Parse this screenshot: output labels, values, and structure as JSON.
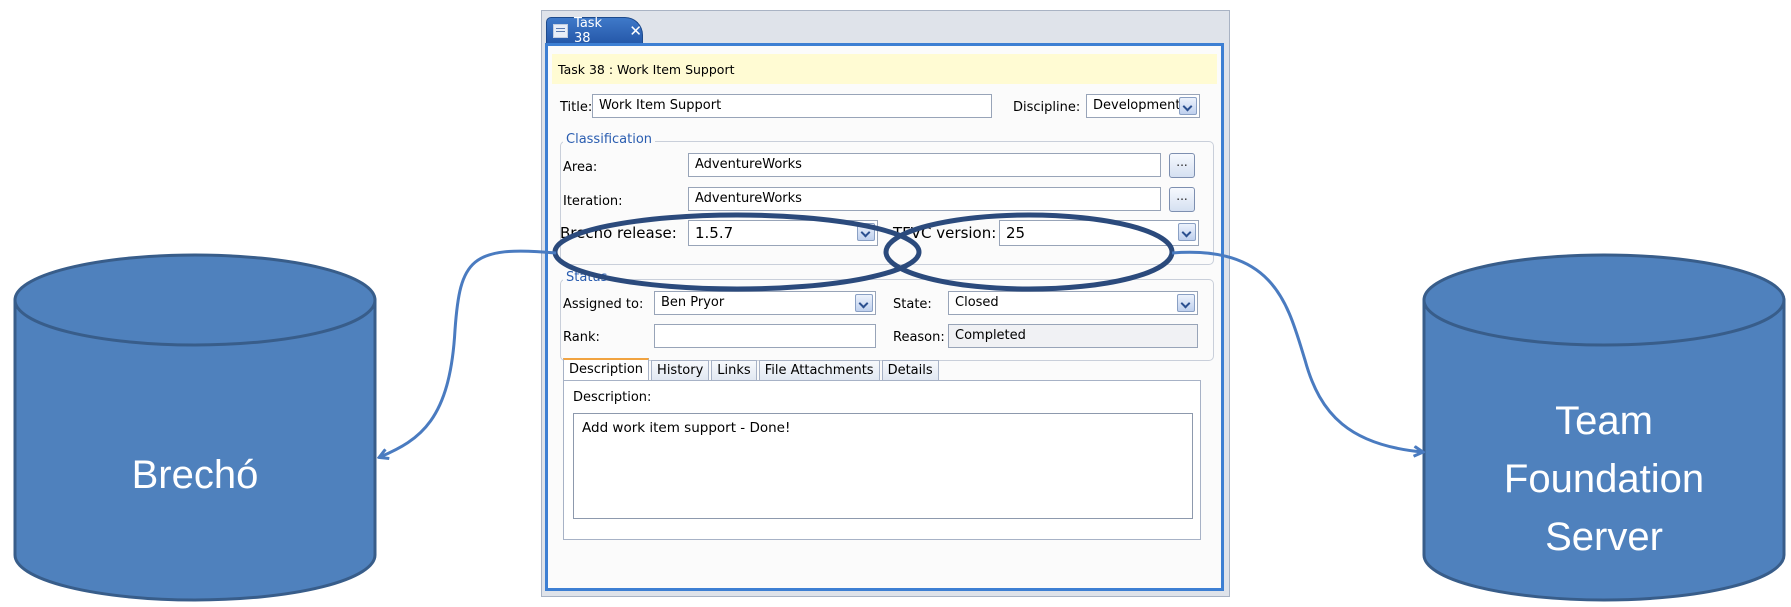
{
  "diagram": {
    "left_database": {
      "label": "Brechó"
    },
    "right_database": {
      "label_lines": [
        "Team",
        "Foundation",
        "Server"
      ]
    },
    "colors": {
      "cylinder_fill": "#4f81bd",
      "cylinder_stroke": "#385d8a",
      "highlight_ellipse": "#2b4a7c",
      "connector": "#4a7bc0"
    }
  },
  "window": {
    "tab_title": "Task 38",
    "tab_close": "✕",
    "header": "Task 38 : Work Item Support",
    "title_label": "Title:",
    "title_value": "Work Item Support",
    "discipline_label": "Discipline:",
    "discipline_value": "Development",
    "classification": {
      "legend": "Classification",
      "area_label": "Area:",
      "area_value": "AdventureWorks",
      "iteration_label": "Iteration:",
      "iteration_value": "AdventureWorks",
      "ellipsis": "...",
      "brecho_release_label": "Brecho release:",
      "brecho_release_value": "1.5.7",
      "tfvc_version_label": "TFVC version:",
      "tfvc_version_value": "25"
    },
    "status": {
      "legend": "Status",
      "assigned_to_label": "Assigned to:",
      "assigned_to_value": "Ben Pryor",
      "state_label": "State:",
      "state_value": "Closed",
      "rank_label": "Rank:",
      "rank_value": "",
      "reason_label": "Reason:",
      "reason_value": "Completed"
    },
    "tabs": [
      "Description",
      "History",
      "Links",
      "File Attachments",
      "Details"
    ],
    "active_tab": "Description",
    "description_label": "Description:",
    "description_value": "Add work item support - Done!"
  }
}
